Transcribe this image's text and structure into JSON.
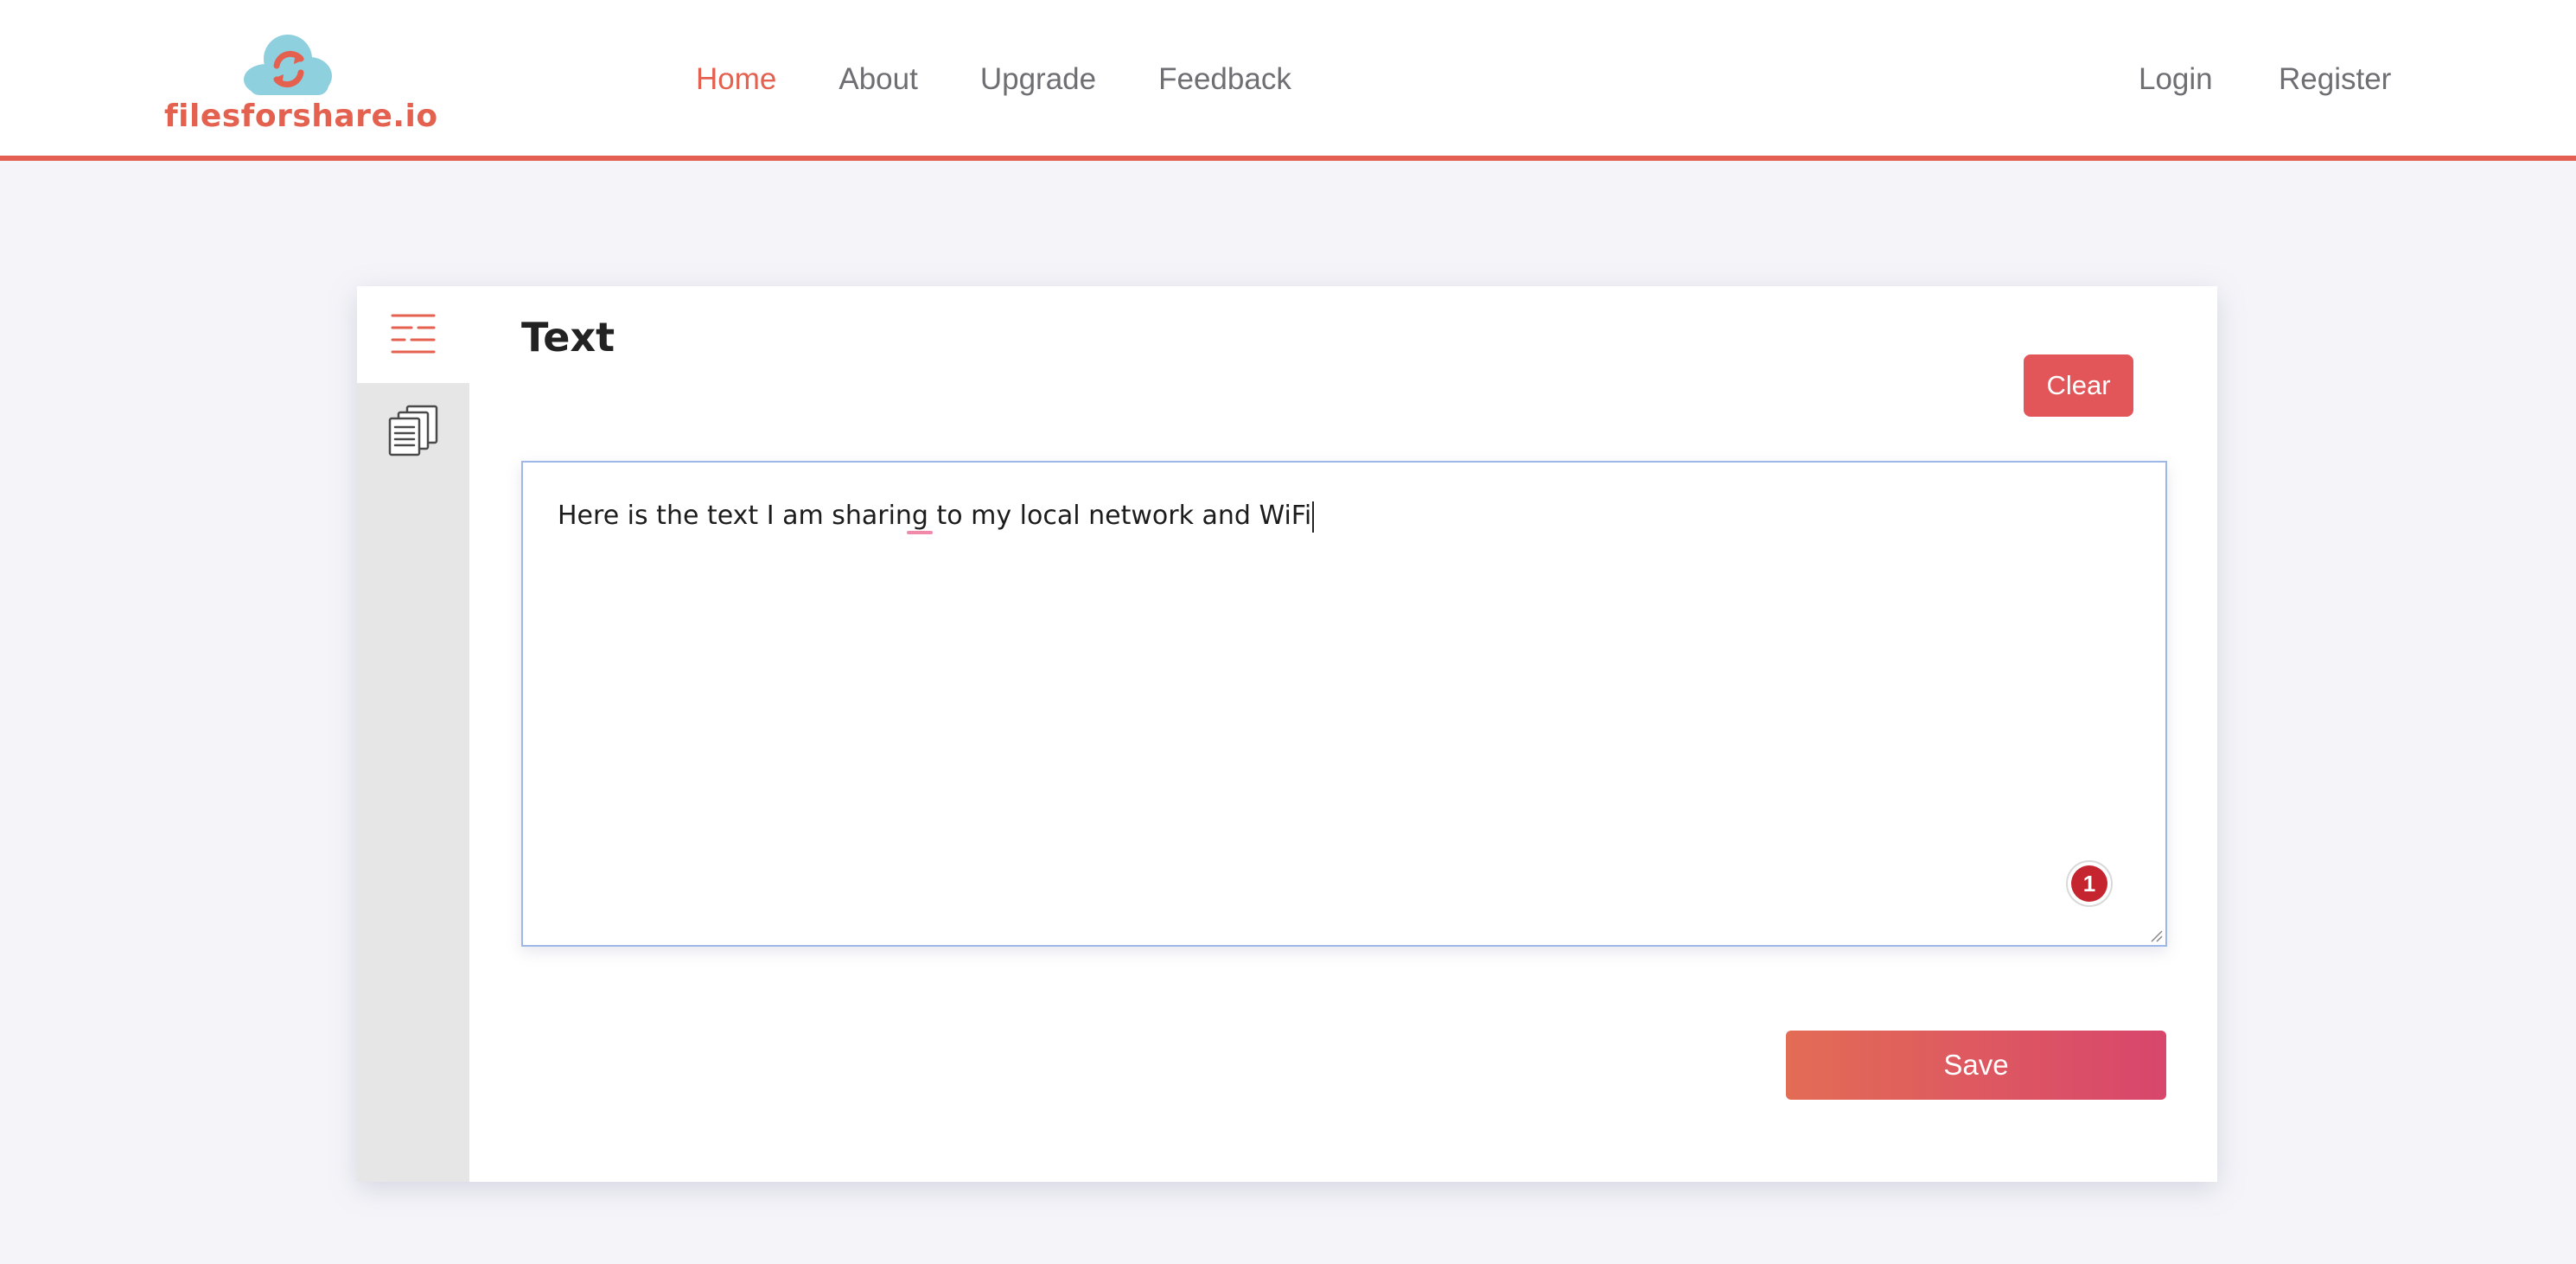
{
  "brand": {
    "name": "filesforshare.io",
    "color": "#e4604f",
    "cloud_color": "#8fd0de"
  },
  "nav": {
    "items": [
      {
        "label": "Home",
        "active": true
      },
      {
        "label": "About",
        "active": false
      },
      {
        "label": "Upgrade",
        "active": false
      },
      {
        "label": "Feedback",
        "active": false
      }
    ]
  },
  "auth": {
    "login_label": "Login",
    "register_label": "Register"
  },
  "sidebar": {
    "tabs": [
      {
        "icon": "text-lines-icon",
        "active": true
      },
      {
        "icon": "documents-icon",
        "active": false
      }
    ]
  },
  "panel": {
    "title": "Text",
    "clear_label": "Clear",
    "text_value": "Here is the text I am sharing to my local network and WiFi",
    "badge_count": "1",
    "save_label": "Save"
  },
  "colors": {
    "accent": "#e4604f",
    "clear_button": "#e2565a",
    "save_gradient_start": "#e36c55",
    "save_gradient_end": "#d8466c",
    "badge": "#c4252e",
    "textarea_border": "#9db7e8"
  }
}
